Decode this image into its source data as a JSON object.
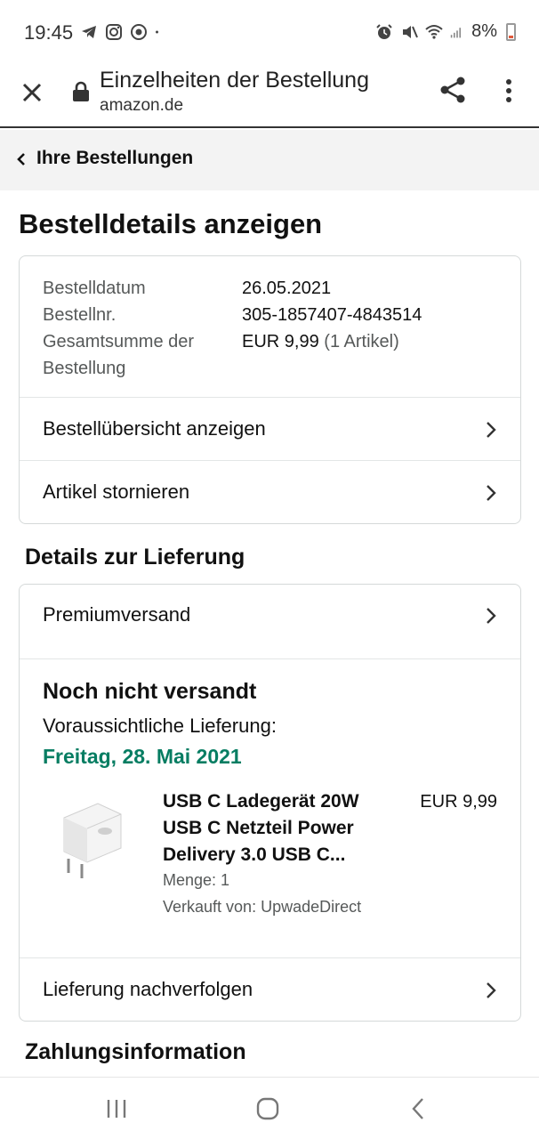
{
  "status_bar": {
    "time": "19:45",
    "battery": "8%",
    "left_icons": [
      "telegram-icon",
      "instagram-icon",
      "chrome-icon",
      "dot-icon"
    ],
    "right_icons": [
      "alarm-icon",
      "mute-icon",
      "wifi-icon",
      "signal-icon",
      "battery-icon"
    ]
  },
  "browser": {
    "title": "Einzelheiten der Bestellung",
    "url": "amazon.de"
  },
  "breadcrumb": {
    "label": "Ihre Bestellungen"
  },
  "page": {
    "title": "Bestelldetails anzeigen"
  },
  "order_summary": {
    "date_label": "Bestelldatum",
    "date_value": "26.05.2021",
    "number_label": "Bestellnr.",
    "number_value": "305-1857407-4843514",
    "total_label_line1": "Gesamtsumme der",
    "total_label_line2": "Bestellung",
    "total_value": "EUR 9,99",
    "total_items": "(1 Artikel)",
    "view_summary": "Bestellübersicht anzeigen",
    "cancel_items": "Artikel stornieren"
  },
  "delivery": {
    "section_title": "Details zur Lieferung",
    "shipping_method": "Premiumversand",
    "status": "Noch nicht versandt",
    "eta_label": "Voraussichtliche Lieferung:",
    "eta_date": "Freitag, 28. Mai 2021",
    "product": {
      "title": "USB C Ladegerät 20W USB C Netzteil Power Delivery 3.0 USB C...",
      "price": "EUR 9,99",
      "quantity": "Menge: 1",
      "seller": "Verkauft von: UpwadeDirect"
    },
    "track": "Lieferung nachverfolgen"
  },
  "payment": {
    "section_title": "Zahlungsinformation"
  },
  "colors": {
    "eta_green": "#067d62",
    "crumb_bg": "#f3f3f3",
    "border": "#d5d9d9",
    "muted": "#565959"
  }
}
